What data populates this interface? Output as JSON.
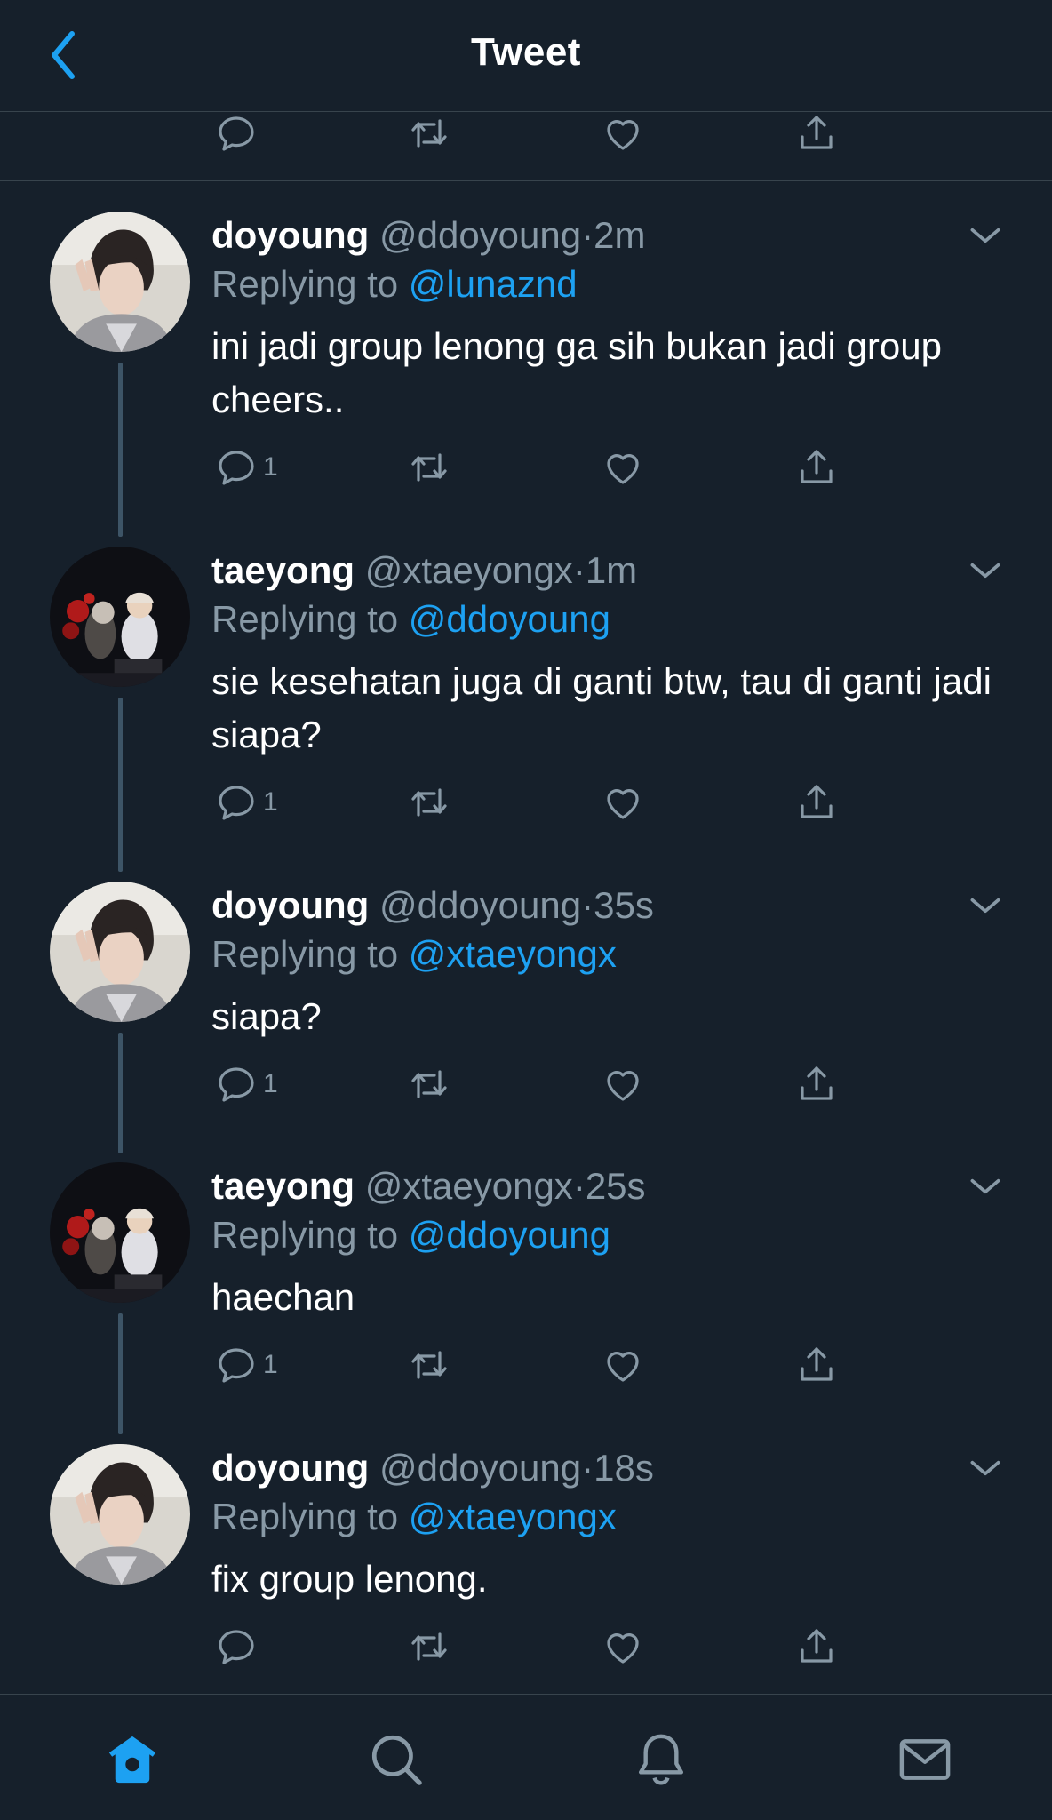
{
  "header": {
    "title": "Tweet"
  },
  "colors": {
    "background": "#16202b",
    "accent": "#1da1f2",
    "muted": "#8899a6",
    "divider": "#38444d"
  },
  "replying_prefix": "Replying to",
  "tweets": [
    {
      "name": "doyoung",
      "handle": "@ddoyoung",
      "dot": "·",
      "time": "2m",
      "reply_to": "@lunaznd",
      "text": "ini jadi group lenong ga sih bukan jadi group cheers..",
      "reply_count": "1"
    },
    {
      "name": "taeyong",
      "handle": "@xtaeyongx",
      "dot": "·",
      "time": "1m",
      "reply_to": "@ddoyoung",
      "text": "sie kesehatan juga di ganti btw, tau di ganti jadi siapa?",
      "reply_count": "1"
    },
    {
      "name": "doyoung",
      "handle": "@ddoyoung",
      "dot": "·",
      "time": "35s",
      "reply_to": "@xtaeyongx",
      "text": "siapa?",
      "reply_count": "1"
    },
    {
      "name": "taeyong",
      "handle": "@xtaeyongx",
      "dot": "·",
      "time": "25s",
      "reply_to": "@ddoyoung",
      "text": "haechan",
      "reply_count": "1"
    },
    {
      "name": "doyoung",
      "handle": "@ddoyoung",
      "dot": "·",
      "time": "18s",
      "reply_to": "@xtaeyongx",
      "text": "fix group lenong.",
      "reply_count": ""
    }
  ],
  "icons": {
    "back": "chevron-left-icon",
    "reply": "speech-bubble-icon",
    "retweet": "retweet-icon",
    "like": "heart-icon",
    "share": "share-icon",
    "more": "chevron-down-icon",
    "nav": [
      "home-icon",
      "search-icon",
      "bell-icon",
      "mail-icon"
    ]
  }
}
